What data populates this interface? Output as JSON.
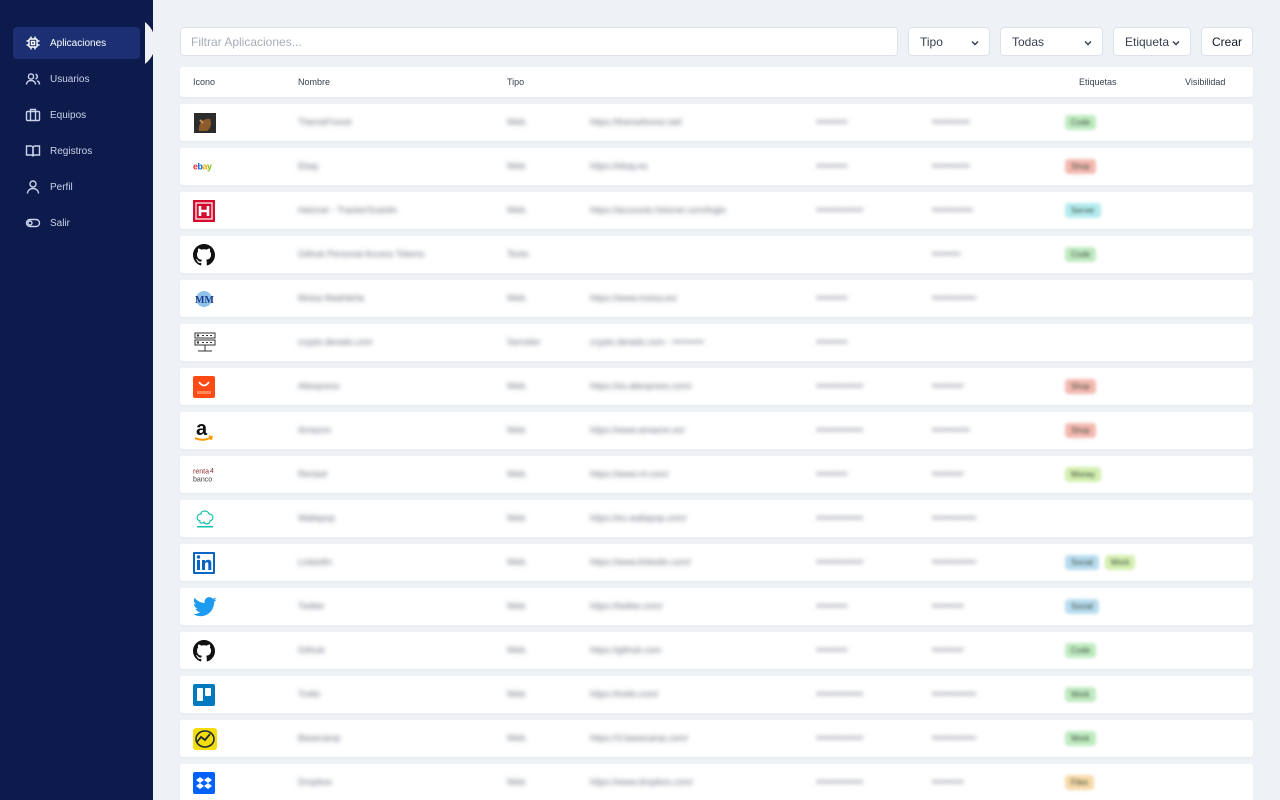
{
  "sidebar": {
    "items": [
      {
        "label": "Aplicaciones",
        "icon": "chip-icon",
        "active": true
      },
      {
        "label": "Usuarios",
        "icon": "users-icon",
        "active": false
      },
      {
        "label": "Equipos",
        "icon": "briefcase-icon",
        "active": false
      },
      {
        "label": "Registros",
        "icon": "book-icon",
        "active": false
      },
      {
        "label": "Perfil",
        "icon": "user-icon",
        "active": false
      },
      {
        "label": "Salir",
        "icon": "toggle-icon",
        "active": false
      }
    ]
  },
  "toolbar": {
    "search_placeholder": "Filtrar Aplicaciones...",
    "type_select": "Tipo",
    "scope_select": "Todas",
    "tag_select": "Etiqueta",
    "create_label": "Crear"
  },
  "table": {
    "headers": {
      "icon": "Icono",
      "name": "Nombre",
      "type": "Tipo",
      "tags": "Etiquetas",
      "visibility": "Visibilidad"
    },
    "rows": [
      {
        "icon": "themeforest-icon",
        "name": "ThemeForest",
        "type": "Web",
        "url": "https://themeforest.net/",
        "user": "••••••••••",
        "pass": "••••••••••••",
        "tags": [
          {
            "label": "Code",
            "color": "#bfeac0"
          }
        ]
      },
      {
        "icon": "ebay-icon",
        "name": "Ebay",
        "type": "Web",
        "url": "https://ebay.es",
        "user": "••••••••••",
        "pass": "••••••••••••",
        "tags": [
          {
            "label": "Shop",
            "color": "#f3b9b0"
          }
        ]
      },
      {
        "icon": "hetzner-icon",
        "name": "Hetzner - TrackerScanlin",
        "type": "Web",
        "url": "https://accounts.hetzner.com/login",
        "user": "•••••••••••••••",
        "pass": "•••••••••••••",
        "tags": [
          {
            "label": "Server",
            "color": "#b4ebef"
          }
        ]
      },
      {
        "icon": "github-icon",
        "name": "Github Personal Access Tokens",
        "type": "Texto",
        "url": "",
        "user": "",
        "pass": "•••••••••",
        "tags": [
          {
            "label": "Code",
            "color": "#bfeac0"
          }
        ]
      },
      {
        "icon": "moisa-icon",
        "name": "Moisa Madrileña",
        "type": "Web",
        "url": "https://www.moisa.es/",
        "user": "••••••••••",
        "pass": "••••••••••••••",
        "tags": []
      },
      {
        "icon": "server-icon",
        "name": "crypto.derado.com",
        "type": "Servidor",
        "url": "crypto.derado.com - ••••••••••",
        "user": "••••••••••",
        "pass": "",
        "tags": []
      },
      {
        "icon": "aliexpress-icon",
        "name": "Aliexpress",
        "type": "Web",
        "url": "https://es.aliexpress.com/",
        "user": "•••••••••••••••",
        "pass": "••••••••••",
        "tags": [
          {
            "label": "Shop",
            "color": "#f3b9b0"
          }
        ]
      },
      {
        "icon": "amazon-icon",
        "name": "Amazon",
        "type": "Web",
        "url": "https://www.amazon.es/",
        "user": "•••••••••••••••",
        "pass": "••••••••••••",
        "tags": [
          {
            "label": "Shop",
            "color": "#f3b9b0"
          }
        ]
      },
      {
        "icon": "renta4-icon",
        "name": "Renta4",
        "type": "Web",
        "url": "https://www.r4.com/",
        "user": "••••••••••",
        "pass": "••••••••••",
        "tags": [
          {
            "label": "Money",
            "color": "#d3efb0"
          }
        ]
      },
      {
        "icon": "wallapop-icon",
        "name": "Wallapop",
        "type": "Web",
        "url": "https://es.wallapop.com/",
        "user": "•••••••••••••••",
        "pass": "••••••••••••••",
        "tags": []
      },
      {
        "icon": "linkedin-icon",
        "name": "LinkedIn",
        "type": "Web",
        "url": "https://www.linkedin.com/",
        "user": "•••••••••••••••",
        "pass": "••••••••••••••",
        "tags": [
          {
            "label": "Social",
            "color": "#b8dcef"
          },
          {
            "label": "Work",
            "color": "#d3efb0"
          }
        ]
      },
      {
        "icon": "twitter-icon",
        "name": "Twitter",
        "type": "Web",
        "url": "https://twitter.com/",
        "user": "••••••••••",
        "pass": "••••••••••",
        "tags": [
          {
            "label": "Social",
            "color": "#b8dcef"
          }
        ]
      },
      {
        "icon": "github-icon",
        "name": "Github",
        "type": "Web",
        "url": "https://github.com",
        "user": "••••••••••",
        "pass": "••••••••••",
        "tags": [
          {
            "label": "Code",
            "color": "#bfeac0"
          }
        ]
      },
      {
        "icon": "trello-icon",
        "name": "Trello",
        "type": "Web",
        "url": "https://trello.com/",
        "user": "•••••••••••••••",
        "pass": "••••••••••••••",
        "tags": [
          {
            "label": "Work",
            "color": "#bfeac0"
          }
        ]
      },
      {
        "icon": "basecamp-icon",
        "name": "Basecamp",
        "type": "Web",
        "url": "https://3.basecamp.com/",
        "user": "•••••••••••••••",
        "pass": "••••••••••••••",
        "tags": [
          {
            "label": "Work",
            "color": "#bfeac0"
          }
        ]
      },
      {
        "icon": "dropbox-icon",
        "name": "Dropbox",
        "type": "Web",
        "url": "https://www.dropbox.com/",
        "user": "•••••••••••••••",
        "pass": "••••••••••",
        "tags": [
          {
            "label": "Files",
            "color": "#f6d9a9"
          }
        ]
      }
    ]
  }
}
